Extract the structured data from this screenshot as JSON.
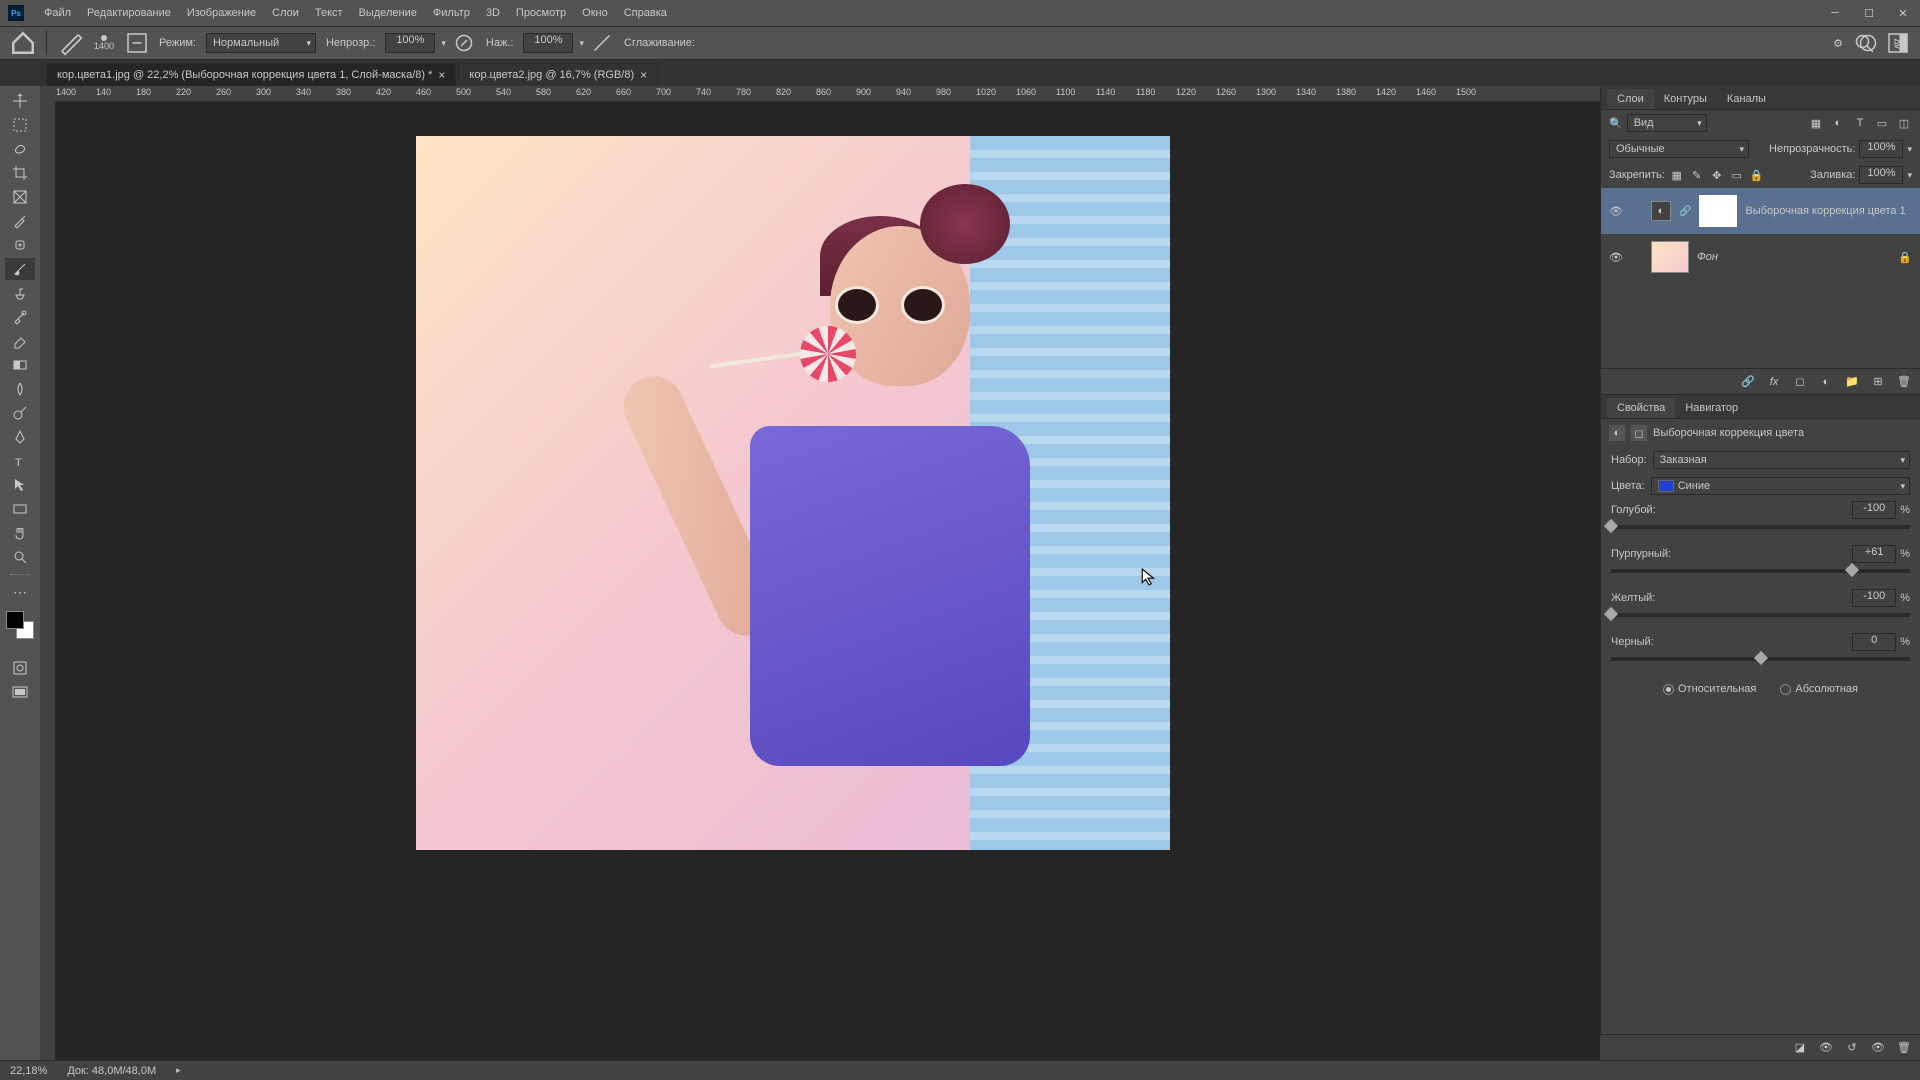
{
  "menu": {
    "items": [
      "Файл",
      "Редактирование",
      "Изображение",
      "Слои",
      "Текст",
      "Выделение",
      "Фильтр",
      "3D",
      "Просмотр",
      "Окно",
      "Справка"
    ]
  },
  "options": {
    "brush_size": "1400",
    "mode_label": "Режим:",
    "mode_value": "Нормальный",
    "opacity_label": "Непрозр.:",
    "opacity_value": "100%",
    "flow_label": "Наж.:",
    "flow_value": "100%",
    "smoothing_label": "Сглаживание:"
  },
  "tabs": [
    {
      "title": "кор.цвета1.jpg @ 22,2% (Выборочная коррекция цвета 1, Слой-маска/8) *",
      "active": true
    },
    {
      "title": "кор.цвета2.jpg @ 16,7% (RGB/8)",
      "active": false
    }
  ],
  "ruler_ticks": [
    "1400",
    "140",
    "180",
    "220",
    "260",
    "300",
    "340",
    "380",
    "420",
    "460",
    "500",
    "540",
    "580",
    "620",
    "660",
    "700",
    "740",
    "780",
    "820",
    "860",
    "900",
    "940",
    "980",
    "1020",
    "1060",
    "1100",
    "1140",
    "1180",
    "1220",
    "1260",
    "1300",
    "1340",
    "1380",
    "1420",
    "1460",
    "1500"
  ],
  "layers_panel": {
    "tabs": [
      "Слои",
      "Контуры",
      "Каналы"
    ],
    "filter_label": "Вид",
    "blend_mode": "Обычные",
    "opacity_label": "Непрозрачность:",
    "opacity_value": "100%",
    "lock_label": "Закрепить:",
    "fill_label": "Заливка:",
    "fill_value": "100%",
    "layers": [
      {
        "name": "Выборочная коррекция цвета 1",
        "type": "adjust"
      },
      {
        "name": "Фон",
        "type": "image"
      }
    ]
  },
  "properties": {
    "tabs": [
      "Свойства",
      "Навигатор"
    ],
    "title": "Выборочная коррекция цвета",
    "preset_label": "Набор:",
    "preset_value": "Заказная",
    "colors_label": "Цвета:",
    "colors_value": "Синие",
    "sliders": [
      {
        "label": "Голубой:",
        "value": "-100",
        "pos": 0
      },
      {
        "label": "Пурпурный:",
        "value": "+61",
        "pos": 80.5
      },
      {
        "label": "Желтый:",
        "value": "-100",
        "pos": 0
      },
      {
        "label": "Черный:",
        "value": "0",
        "pos": 50
      }
    ],
    "method_relative": "Относительная",
    "method_absolute": "Абсолютная"
  },
  "status": {
    "zoom": "22,18%",
    "doc": "Док: 48,0M/48,0M"
  }
}
